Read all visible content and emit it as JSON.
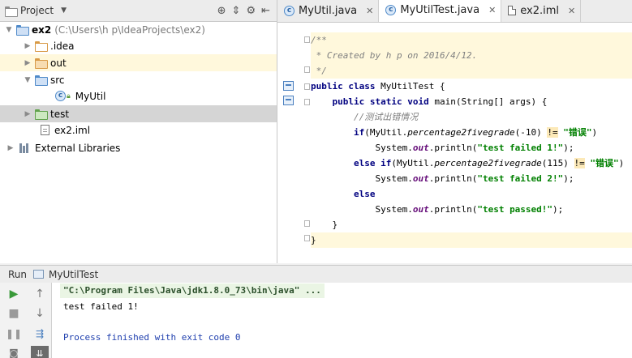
{
  "project_panel": {
    "title": "Project",
    "tree": [
      {
        "label": "ex2",
        "path": "(C:\\Users\\h p\\IdeaProjects\\ex2)",
        "expanded": true
      },
      {
        "label": ".idea",
        "expanded": false
      },
      {
        "label": "out",
        "expanded": false
      },
      {
        "label": "src",
        "expanded": true
      },
      {
        "label": "MyUtil"
      },
      {
        "label": "test",
        "expanded": false
      },
      {
        "label": "ex2.iml"
      },
      {
        "label": "External Libraries",
        "expanded": false
      }
    ]
  },
  "editor": {
    "tabs": [
      {
        "label": "MyUtil.java",
        "active": false
      },
      {
        "label": "MyUtilTest.java",
        "active": true
      },
      {
        "label": "ex2.iml",
        "active": false
      }
    ],
    "code": {
      "l1": "/**",
      "l2": " * Created by h p on 2016/4/12.",
      "l3": " */",
      "l4_kw": "public class",
      "l4_name": " MyUtilTest {",
      "l5_kw": "public static void",
      "l5_rest": " main(String[] args) {",
      "l6": "//测试出错情况",
      "l7_kw": "if",
      "l7_a": "(MyUtil.",
      "l7_m": "percentage2fivegrade",
      "l7_arg": "(-10) ",
      "l7_op": "!=",
      "l7_s": " \"错误\"",
      "l7_end": ")",
      "l8_a": "System.",
      "l8_f": "out",
      "l8_b": ".println(",
      "l8_s": "\"test failed 1!\"",
      "l8_end": ");",
      "l9_kw": "else if",
      "l9_a": "(MyUtil.",
      "l9_m": "percentage2fivegrade",
      "l9_arg": "(115) ",
      "l9_op": "!=",
      "l9_s": " \"错误\"",
      "l9_end": ")",
      "l10_a": "System.",
      "l10_f": "out",
      "l10_b": ".println(",
      "l10_s": "\"test failed 2!\"",
      "l10_end": ");",
      "l11_kw": "else",
      "l12_a": "System.",
      "l12_f": "out",
      "l12_b": ".println(",
      "l12_s": "\"test passed!\"",
      "l12_end": ");",
      "l13": "}",
      "l14": "}"
    }
  },
  "run_panel": {
    "label": "Run",
    "config": "MyUtilTest",
    "console": [
      "\"C:\\Program Files\\Java\\jdk1.8.0_73\\bin\\java\" ...",
      "test failed 1!",
      "Process finished with exit code 0"
    ]
  }
}
